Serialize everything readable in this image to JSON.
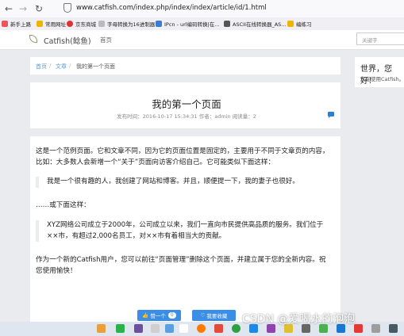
{
  "browser": {
    "url": "www.catfish.com/index.php/index/index/article/id/1.html",
    "bookmarks": [
      "新手上路",
      "常用网址",
      "京东商城",
      "字母转换为16进制器",
      "IPcn - url编码转换|在...",
      "ASCII在线转换器_AS...",
      "编练习"
    ]
  },
  "header": {
    "brand": "Catfish(鲶鱼)",
    "nav_home": "首页",
    "search_placeholder": "关键字"
  },
  "breadcrumb": {
    "home": "首页",
    "separator": "/",
    "category": "文章",
    "current": "我的第一个页面"
  },
  "article": {
    "title": "我的第一个页面",
    "meta": "发布时间：2016-10-17 15:34:31 作者：admin 阅读量：2",
    "paragraph1": "这是一个范例页面。它和文章不同，因为它的页面位置是固定的，主要用于不同于文章页的内容，比如：大多数人会新增一个“关于”页面向访客介绍自己。它可能类似下面这样：",
    "quote1": "我是一个很有趣的人，我创建了网站和博客。并且，顺便提一下，我的妻子也很好。",
    "paragraph2": "……或下面这样：",
    "quote2": "XYZ网络公司成立于2000年，公司成立以来，我们一直向市民提供高品质的服务。我们位于××市，有超过2,000名员工，对××市有着相当大的贡献。",
    "paragraph3": "作为一个新的Catfish用户，您可以前往“页面管理”删除这个页面，并建立属于您的全新内容。祝您使用愉快！",
    "like_label": "赞一个",
    "like_count": "0",
    "favorite_label": "我要收藏"
  },
  "sidebar": {
    "title": "世界，您好！",
    "text": "欢迎使用Catfish。"
  },
  "watermark": "CSDN @爱喝水的泡泡",
  "colors": {
    "accent": "#3a8ee6",
    "link": "#5b9bd5",
    "page_bg": "#e9ebee"
  }
}
